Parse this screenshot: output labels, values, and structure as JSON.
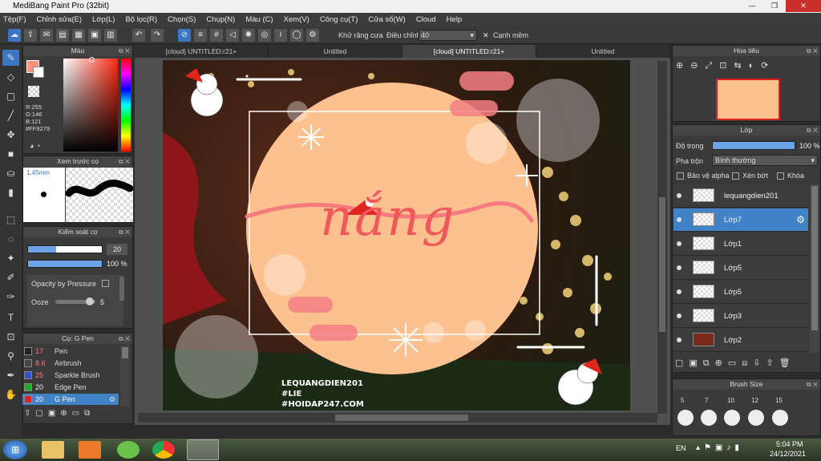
{
  "window": {
    "title": "MediBang Paint Pro (32bit)"
  },
  "menu": [
    "Tệp(F)",
    "Chỉnh sửa(E)",
    "Lớp(L)",
    "Bộ lọc(R)",
    "Chọn(S)",
    "Chụp(N)",
    "Màu (C)",
    "Xem(V)",
    "Công cụ(T)",
    "Cửa sổ(W)",
    "Cloud",
    "Help"
  ],
  "toolbar": {
    "antialias_label": "Khử răng cưa",
    "adjust_label": "Điều chỉnh",
    "adjust_value": "40",
    "snap_label": "Cạnh mềm"
  },
  "tabs": [
    "[cloud] UNTITLED:r21+",
    "Untitled",
    "[cloud] UNTITLED:r21+",
    "Untitled"
  ],
  "color_panel": {
    "title": "Màu",
    "r": "R:255",
    "g": "G:146",
    "b": "B:121",
    "hex": "#FF9279",
    "primary_color": "#ff9279"
  },
  "brush_preview": {
    "title": "Xem trước cọ",
    "size": "1.45mm"
  },
  "brush_control": {
    "title": "Kiểm soát cọ",
    "size_value": "20",
    "opacity_value": "100 %",
    "opacity_by_pressure": "Opacity by Pressure",
    "ooze_label": "Ooze",
    "ooze_value": "5"
  },
  "brush_list": {
    "title": "Cọ: G Pen",
    "items": [
      {
        "size": "17",
        "name": "Pen",
        "color": "#222222"
      },
      {
        "size": "8.6",
        "name": "Airbrush",
        "color": "#444444"
      },
      {
        "size": "25",
        "name": "Sparkle Brush",
        "color": "#3355cc"
      },
      {
        "size": "20",
        "name": "Edge Pen",
        "color": "#22aa22"
      },
      {
        "size": "20",
        "name": "G Pen",
        "color": "#dd2222"
      }
    ]
  },
  "navigator": {
    "title": "Hoa tiêu"
  },
  "layers": {
    "title": "Lớp",
    "opacity_label": "Độ trong",
    "opacity_value": "100 %",
    "blend_label": "Pha trộn",
    "blend_value": "Bình thường",
    "protect_alpha": "Bảo vệ alpha",
    "clipping": "Xén bớt",
    "lock": "Khóa",
    "items": [
      "lequangdien201",
      "Lớp7",
      "Lớp1",
      "Lớp5",
      "Lớp5",
      "Lớp3",
      "Lớp2"
    ]
  },
  "brush_size": {
    "title": "Brush Size",
    "sizes": [
      "5",
      "7",
      "10",
      "12",
      "15"
    ]
  },
  "artwork": {
    "main_text": "nắng",
    "watermark1": "LEQUANGDIEN201",
    "watermark2": "#LIE",
    "watermark3": "#HOIDAP247.COM"
  },
  "taskbar": {
    "lang": "EN",
    "time": "5:04 PM",
    "date": "24/12/2021"
  }
}
